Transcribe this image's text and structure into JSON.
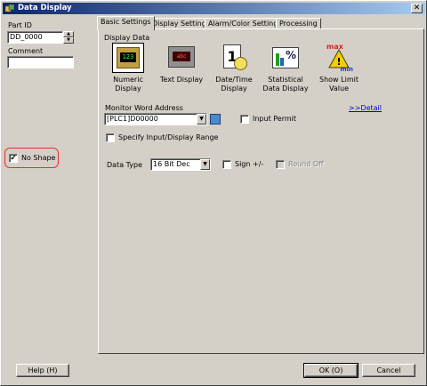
{
  "window": {
    "title": "Data Display",
    "close": "✕"
  },
  "left": {
    "part_id_label": "Part ID",
    "part_id_value": "DD_0000",
    "comment_label": "Comment",
    "comment_value": "",
    "no_shape_label": "No Shape",
    "no_shape_checked": true
  },
  "tabs": [
    {
      "label": "Basic Settings",
      "active": true
    },
    {
      "label": "Display Settings",
      "active": false
    },
    {
      "label": "Alarm/Color Settings",
      "active": false
    },
    {
      "label": "Processing",
      "active": false
    }
  ],
  "display_data": {
    "group_label": "Display Data",
    "items": [
      {
        "label_line1": "Numeric",
        "label_line2": "Display",
        "icon": "numeric-display-icon",
        "selected": true,
        "icon_text": "123"
      },
      {
        "label_line1": "Text Display",
        "label_line2": "",
        "icon": "text-display-icon",
        "selected": false,
        "icon_text": "abc"
      },
      {
        "label_line1": "Date/Time",
        "label_line2": "Display",
        "icon": "date-time-display-icon",
        "selected": false,
        "icon_text": "1"
      },
      {
        "label_line1": "Statistical",
        "label_line2": "Data Display",
        "icon": "statistical-data-display-icon",
        "selected": false,
        "icon_text": "%"
      },
      {
        "label_line1": "Show Limit Value",
        "label_line2": "",
        "icon": "show-limit-value-icon",
        "selected": false,
        "icon_text_top": "max",
        "icon_text_bottom": "min"
      }
    ]
  },
  "monitor": {
    "address_label": "Monitor Word Address",
    "address_value": "[PLC1]D00000",
    "detail_link": ">>Detail",
    "input_permit_label": "Input Permit",
    "specify_range_label": "Specify Input/Display Range",
    "data_type_label": "Data Type",
    "data_type_value": "16 Bit Dec",
    "sign_label": "Sign +/-",
    "round_off_label": "Round Off"
  },
  "footer": {
    "help_label": "Help (H)",
    "ok_label": "OK (O)",
    "cancel_label": "Cancel"
  },
  "colors": {
    "title_start": "#0a246a",
    "title_end": "#a6caf0",
    "highlight": "#e03030",
    "link": "#0000ee"
  }
}
